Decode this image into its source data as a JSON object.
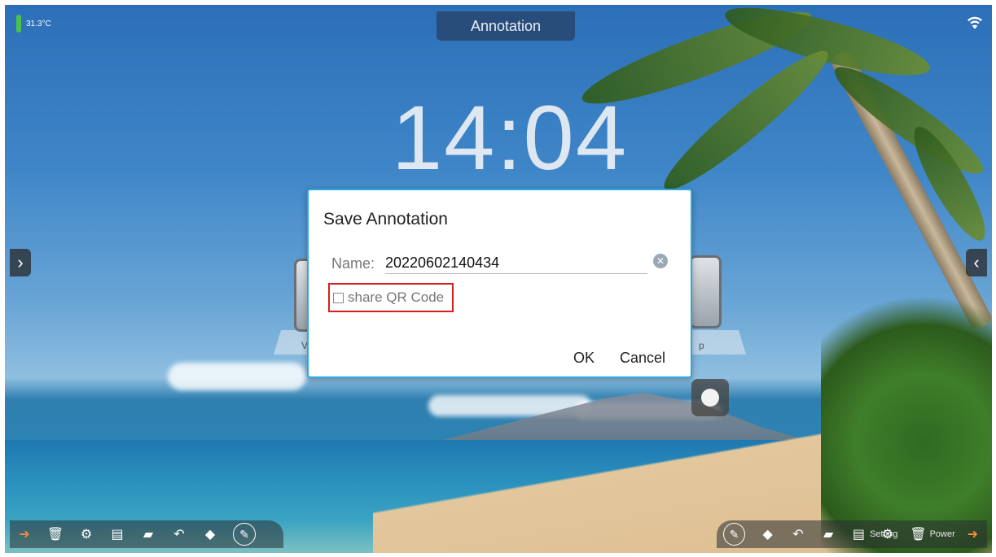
{
  "status_bar": {
    "temperature": "31.3°C",
    "title": "Annotation"
  },
  "home": {
    "clock": "14:04",
    "tile_left_label": "V",
    "tile_right_label": "p"
  },
  "dialog": {
    "title": "Save Annotation",
    "name_label": "Name:",
    "name_value": "20220602140434",
    "share_label": "share QR Code",
    "share_checked": false,
    "ok_label": "OK",
    "cancel_label": "Cancel"
  },
  "toolbar_right": {
    "setting_label": "Setting",
    "power_label": "Power"
  },
  "colors": {
    "dialog_border": "#29a7e0",
    "highlight_box": "#d62020",
    "exit_icon": "#f28b3a"
  }
}
